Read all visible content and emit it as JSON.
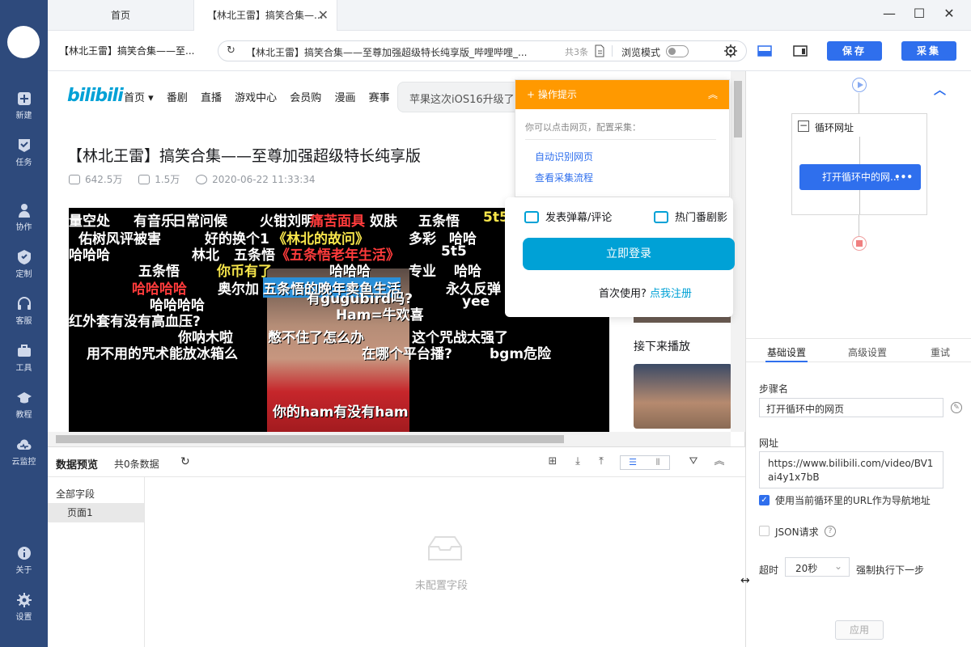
{
  "rail": {
    "items": [
      {
        "label": "新建",
        "icon": "plus-square-icon"
      },
      {
        "label": "任务",
        "icon": "task-flag-icon"
      },
      {
        "label": "协作",
        "icon": "people-icon"
      },
      {
        "label": "定制",
        "icon": "heart-shield-icon"
      },
      {
        "label": "客服",
        "icon": "headset-icon"
      },
      {
        "label": "工具",
        "icon": "toolbox-icon"
      },
      {
        "label": "教程",
        "icon": "graduation-cap-icon"
      },
      {
        "label": "云监控",
        "icon": "cloud-monitor-icon"
      },
      {
        "label": "关于",
        "icon": "info-icon"
      },
      {
        "label": "设置",
        "icon": "gear-icon"
      }
    ]
  },
  "tabs": {
    "home": "首页",
    "active": "【林北王雷】搞笑合集—...",
    "close": "✕"
  },
  "window": {
    "minimize": "—",
    "maximize": "☐",
    "close": "✕"
  },
  "addr": {
    "page_title": "【林北王雷】搞笑合集——至...",
    "url_text": "【林北王雷】搞笑合集——至尊加强超级特长纯享版_哔哩哔哩_...",
    "count": "共3条",
    "browse_mode": "浏览模式",
    "save": "保存",
    "collect": "采集"
  },
  "bili": {
    "logo": "bilibili",
    "nav": [
      "首页 ▾",
      "番剧",
      "直播",
      "游戏中心",
      "会员购",
      "漫画",
      "赛事"
    ],
    "search_placeholder": "苹果这次iOS16升级了",
    "video_title": "【林北王雷】搞笑合集——至尊加强超级特长纯享版",
    "views": "642.5万",
    "danmaku_count": "1.5万",
    "date": "2020-06-22 11:33:34",
    "next_title": "接下来播放",
    "danmaku": [
      {
        "text": "量空处",
        "c": ""
      },
      {
        "text": "有音乐",
        "c": ""
      },
      {
        "text": "日常问候",
        "c": ""
      },
      {
        "text": "火钳刘明",
        "c": ""
      },
      {
        "text": "痛苦面具",
        "c": "r"
      },
      {
        "text": "奴肤",
        "c": ""
      },
      {
        "text": "五条悟",
        "c": ""
      },
      {
        "text": "5t5",
        "c": "y"
      },
      {
        "text": "佑树风评被害",
        "c": ""
      },
      {
        "text": "好的换个1",
        "c": ""
      },
      {
        "text": "《林北的故问》",
        "c": "y"
      },
      {
        "text": "多彩",
        "c": ""
      },
      {
        "text": "哈哈",
        "c": ""
      },
      {
        "text": "哈哈哈",
        "c": ""
      },
      {
        "text": "林北",
        "c": ""
      },
      {
        "text": "五条悟",
        "c": ""
      },
      {
        "text": "《五条悟老年生活》",
        "c": "r"
      },
      {
        "text": "5t5",
        "c": ""
      },
      {
        "text": "五条悟",
        "c": ""
      },
      {
        "text": "你币有了",
        "c": "y"
      },
      {
        "text": "哈哈哈",
        "c": ""
      },
      {
        "text": "专业",
        "c": ""
      },
      {
        "text": "哈哈",
        "c": ""
      },
      {
        "text": "哈哈哈哈",
        "c": "r"
      },
      {
        "text": "奥尔加",
        "c": ""
      },
      {
        "text": "五条悟的晚年卖鱼生活",
        "c": "b"
      },
      {
        "text": "永久反弹",
        "c": ""
      },
      {
        "text": "哈哈哈哈",
        "c": ""
      },
      {
        "text": "有gugubird吗?",
        "c": ""
      },
      {
        "text": "yee",
        "c": ""
      },
      {
        "text": "红外套有没有高血压?",
        "c": ""
      },
      {
        "text": "Ham=牛欢喜",
        "c": ""
      },
      {
        "text": "你呐木啦",
        "c": ""
      },
      {
        "text": "憋不住了怎么办",
        "c": ""
      },
      {
        "text": "这个咒战太强了",
        "c": ""
      },
      {
        "text": "用不用的咒术能放冰箱么",
        "c": ""
      },
      {
        "text": "在哪个平台播?",
        "c": ""
      },
      {
        "text": "bgm危险",
        "c": ""
      },
      {
        "text": "你的ham有没有ham",
        "c": ""
      }
    ]
  },
  "tips": {
    "header": "+ 操作提示",
    "hint": "你可以点击网页，配置采集：",
    "link1": "自动识别网页",
    "link2": "查看采集流程"
  },
  "login": {
    "opt1": "发表弹幕/评论",
    "opt2": "热门番剧影",
    "button": "立即登录",
    "first_use": "首次使用? ",
    "register": "点我注册"
  },
  "preview": {
    "title": "数据预览",
    "count": "共0条数据",
    "all_fields": "全部字段",
    "page1": "页面1",
    "empty": "未配置字段"
  },
  "flow": {
    "loop_label": "循环网址",
    "step_label": "打开循环中的网...",
    "step_more": "•••"
  },
  "settings": {
    "tabs": [
      "基础设置",
      "高级设置",
      "重试"
    ],
    "step_name_label": "步骤名",
    "step_name_value": "打开循环中的网页",
    "url_label": "网址",
    "url_value": "https://www.bilibili.com/video/BV1ai4y1x7bB",
    "use_loop_url": "使用当前循环里的URL作为导航地址",
    "json_request": "JSON请求",
    "timeout_label": "超时",
    "timeout_value": "20秒",
    "force_next": "强制执行下一步",
    "apply": "应用"
  }
}
